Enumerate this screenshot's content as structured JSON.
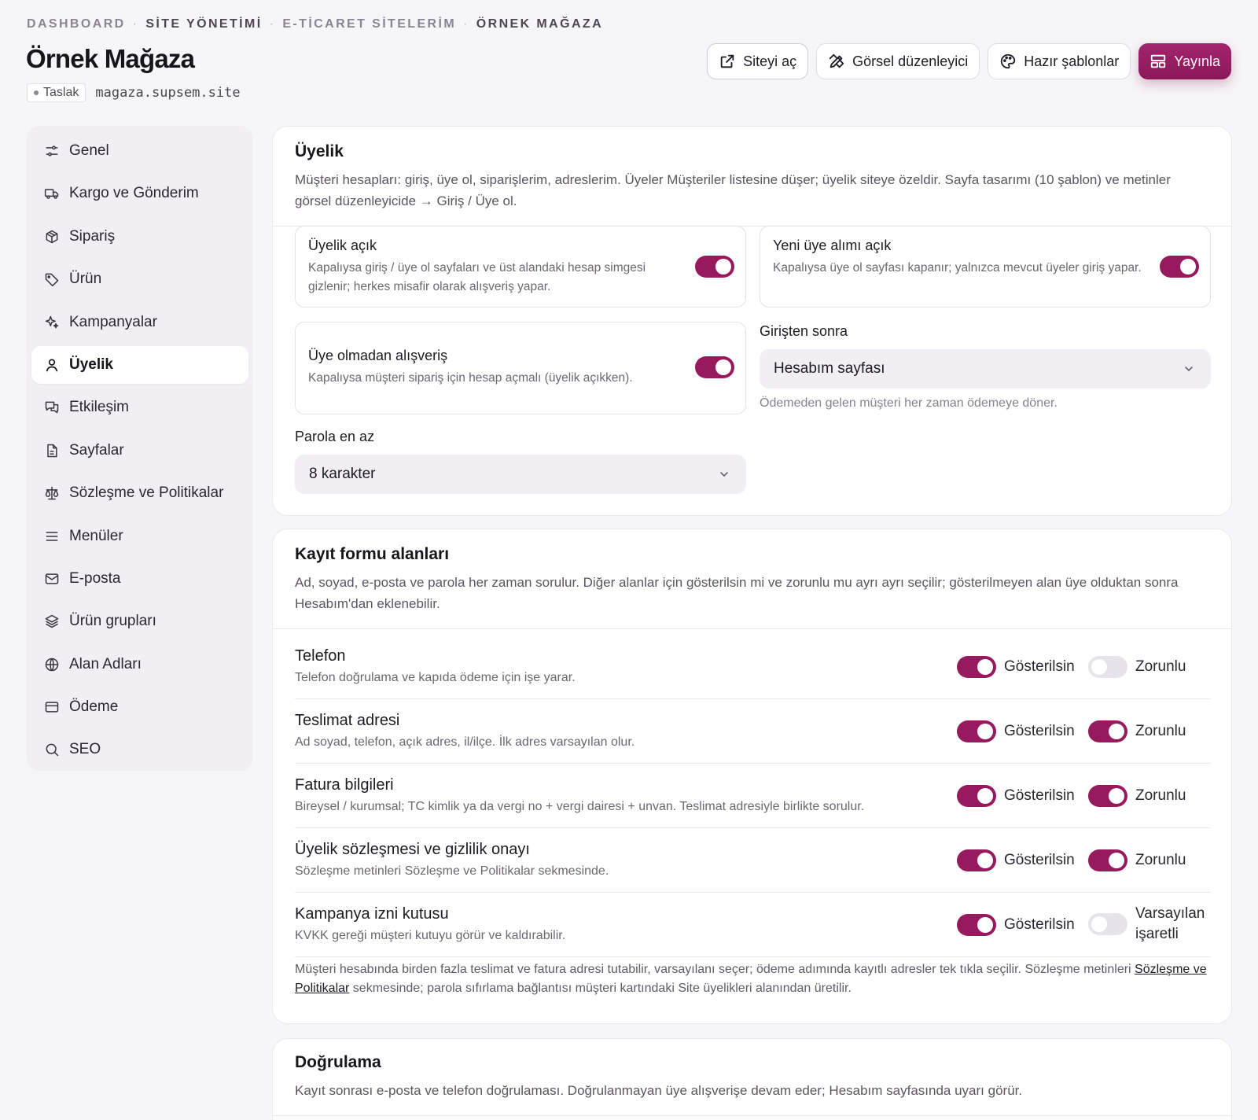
{
  "breadcrumb": [
    "DASHBOARD",
    "SİTE YÖNETİMİ",
    "E-TİCARET SİTELERİM",
    "ÖRNEK MAĞAZA"
  ],
  "page": {
    "title": "Örnek Mağaza",
    "status": "Taslak",
    "domain": "magaza.supsem.site"
  },
  "actions": {
    "open_site": "Siteyi aç",
    "visual_editor": "Görsel düzenleyici",
    "templates": "Hazır şablonlar",
    "publish": "Yayınla"
  },
  "sidebar": {
    "items": [
      {
        "label": "Genel",
        "icon": "sliders-icon"
      },
      {
        "label": "Kargo ve Gönderim",
        "icon": "truck-icon"
      },
      {
        "label": "Sipariş",
        "icon": "package-icon"
      },
      {
        "label": "Ürün",
        "icon": "tag-icon"
      },
      {
        "label": "Kampanyalar",
        "icon": "sparkles-icon"
      },
      {
        "label": "Üyelik",
        "icon": "user-icon",
        "active": true
      },
      {
        "label": "Etkileşim",
        "icon": "chat-icon"
      },
      {
        "label": "Sayfalar",
        "icon": "file-icon"
      },
      {
        "label": "Sözleşme ve Politikalar",
        "icon": "scale-icon"
      },
      {
        "label": "Menüler",
        "icon": "menu-icon"
      },
      {
        "label": "E-posta",
        "icon": "mail-icon"
      },
      {
        "label": "Ürün grupları",
        "icon": "layers-icon"
      },
      {
        "label": "Alan Adları",
        "icon": "globe-icon"
      },
      {
        "label": "Ödeme",
        "icon": "card-icon"
      },
      {
        "label": "SEO",
        "icon": "search-icon"
      }
    ]
  },
  "membership": {
    "title": "Üyelik",
    "description": "Müşteri hesapları: giriş, üye ol, siparişlerim, adreslerim. Üyeler Müşteriler listesine düşer; üyelik siteye özeldir. Sayfa tasarımı (10 şablon) ve metinler görsel düzenleyicide → Giriş / Üye ol.",
    "membership_open": {
      "title": "Üyelik açık",
      "desc": "Kapalıysa giriş / üye ol sayfaları ve üst alandaki hesap simgesi gizlenir; herkes misafir olarak alışveriş yapar.",
      "on": true
    },
    "new_members": {
      "title": "Yeni üye alımı açık",
      "desc": "Kapalıysa üye ol sayfası kapanır; yalnızca mevcut üyeler giriş yapar.",
      "on": true
    },
    "guest_checkout": {
      "title": "Üye olmadan alışveriş",
      "desc": "Kapalıysa müşteri sipariş için hesap açmalı (üyelik açıkken).",
      "on": true
    },
    "after_login": {
      "label": "Girişten sonra",
      "value": "Hesabım sayfası",
      "helper": "Ödemeden gelen müşteri her zaman ödemeye döner."
    },
    "password_min": {
      "label": "Parola en az",
      "value": "8 karakter"
    }
  },
  "registration": {
    "title": "Kayıt formu alanları",
    "description": "Ad, soyad, e-posta ve parola her zaman sorulur. Diğer alanlar için gösterilsin mi ve zorunlu mu ayrı ayrı seçilir; gösterilmeyen alan üye olduktan sonra Hesabım'dan eklenebilir.",
    "show_label": "Gösterilsin",
    "required_label": "Zorunlu",
    "default_checked_label": "Varsayılan işaretli",
    "rows": [
      {
        "title": "Telefon",
        "desc": "Telefon doğrulama ve kapıda ödeme için işe yarar.",
        "show": true,
        "second": false,
        "second_label": "Zorunlu"
      },
      {
        "title": "Teslimat adresi",
        "desc": "Ad soyad, telefon, açık adres, il/ilçe. İlk adres varsayılan olur.",
        "show": true,
        "second": true,
        "second_label": "Zorunlu"
      },
      {
        "title": "Fatura bilgileri",
        "desc": "Bireysel / kurumsal; TC kimlik ya da vergi no + vergi dairesi + unvan. Teslimat adresiyle birlikte sorulur.",
        "show": true,
        "second": true,
        "second_label": "Zorunlu"
      },
      {
        "title": "Üyelik sözleşmesi ve gizlilik onayı",
        "desc": "Sözleşme metinleri Sözleşme ve Politikalar sekmesinde.",
        "show": true,
        "second": true,
        "second_label": "Zorunlu"
      },
      {
        "title": "Kampanya izni kutusu",
        "desc": "KVKK gereği müşteri kutuyu görür ve kaldırabilir.",
        "show": true,
        "second": false,
        "second_label": "Varsayılan işaretli"
      }
    ],
    "note_before": "Müşteri hesabında birden fazla teslimat ve fatura adresi tutabilir, varsayılanı seçer; ödeme adımında kayıtlı adresler tek tıkla seçilir. Sözleşme metinleri ",
    "note_link": "Sözleşme ve Politikalar",
    "note_after": " sekmesinde; parola sıfırlama bağlantısı müşteri kartındaki Site üyelikleri alanından üretilir."
  },
  "verification": {
    "title": "Doğrulama",
    "description": "Kayıt sonrası e-posta ve telefon doğrulaması. Doğrulanmayan üye alışverişe devam eder; Hesabım sayfasında uyarı görür."
  }
}
